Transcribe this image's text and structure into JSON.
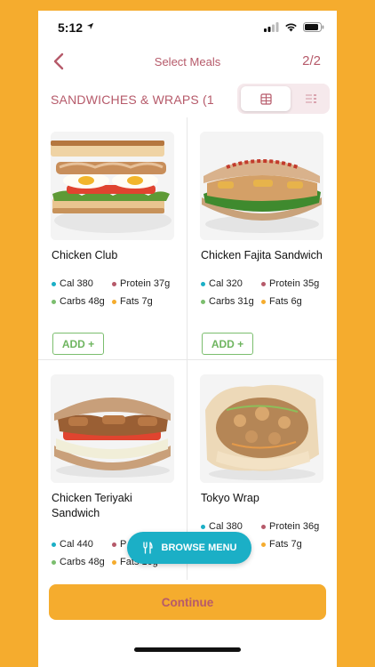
{
  "status_bar": {
    "time": "5:12"
  },
  "nav": {
    "title": "Select Meals",
    "step": "2/2"
  },
  "category": {
    "title": "SANDWICHES & WRAPS (1..."
  },
  "colors": {
    "accent": "#B65A6A",
    "background": "#F5AC2E",
    "teal": "#1BAFC6",
    "green": "#6FB560"
  },
  "meals": [
    {
      "name": "Chicken Club",
      "cal": "Cal 380",
      "protein": "Protein 37g",
      "carbs": "Carbs 48g",
      "fats": "Fats 7g",
      "add": "ADD +"
    },
    {
      "name": "Chicken Fajita Sandwich",
      "cal": "Cal 320",
      "protein": "Protein 35g",
      "carbs": "Carbs 31g",
      "fats": "Fats 6g",
      "add": "ADD +"
    },
    {
      "name": "Chicken Teriyaki Sandwich",
      "cal": "Cal 440",
      "protein": "P",
      "carbs": "Carbs 48g",
      "fats": "Fats 10g"
    },
    {
      "name": "Tokyo Wrap",
      "cal": "Cal 380",
      "protein": "Protein 36g",
      "carbs": "",
      "fats": "Fats 7g"
    }
  ],
  "browse_menu": {
    "label": "BROWSE MENU"
  },
  "continue": {
    "label": "Continue"
  }
}
